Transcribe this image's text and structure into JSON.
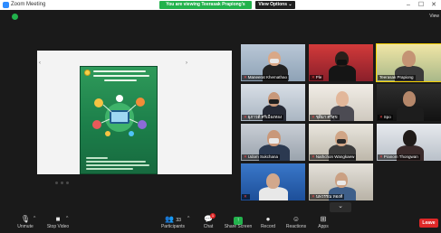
{
  "window": {
    "title": "Zoom Meeting",
    "controls": [
      "–",
      "☐",
      "✕"
    ]
  },
  "banner": {
    "share_text": "You are viewing Teerasak Prapiong's screen",
    "view_options_label": "View Options ⌄"
  },
  "meeting": {
    "view_label": "View"
  },
  "gallery": {
    "tiles": [
      {
        "name": "Maneerat Khemathao",
        "muted": true
      },
      {
        "name": "Ple",
        "muted": true
      },
      {
        "name": "Teerasak Prapiong",
        "muted": false
      },
      {
        "name": "ยุภาวดี ศรีเมืองทอง",
        "muted": true
      },
      {
        "name": "ชุติมา ศรีสุข",
        "muted": true
      },
      {
        "name": "Spo",
        "muted": true
      },
      {
        "name": "Udom Sukchana",
        "muted": true
      },
      {
        "name": "Nathchon Wangkaew",
        "muted": true
      },
      {
        "name": "Pranom Thongwan",
        "muted": true
      },
      {
        "name": "",
        "muted": true
      },
      {
        "name": "นพวรรณ ทองดี",
        "muted": true
      },
      {
        "name": "",
        "muted": false
      }
    ],
    "scroll_glyph": "⌄"
  },
  "toolbar": {
    "unmute": "Unmute",
    "stop_video": "Stop Video",
    "participants": "Participants",
    "participants_count": "33",
    "chat": "Chat",
    "chat_badge": "1",
    "share_screen": "Share Screen",
    "record": "Record",
    "reactions": "Reactions",
    "apps": "Apps",
    "leave": "Leave"
  }
}
